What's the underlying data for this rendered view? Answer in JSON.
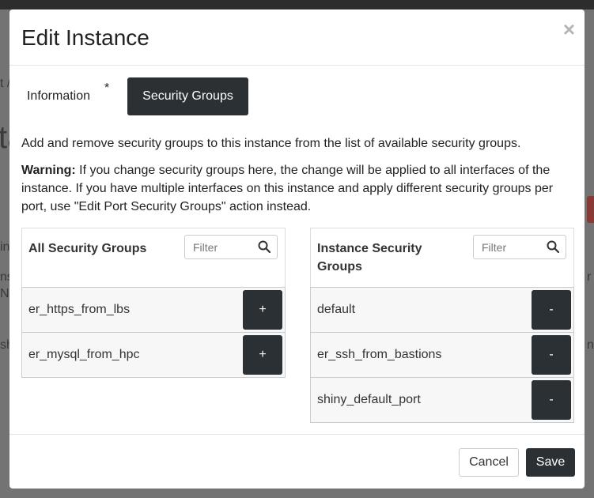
{
  "modal": {
    "title": "Edit Instance",
    "close_glyph": "×"
  },
  "tabs": [
    {
      "label": "Information",
      "required_marker": "*",
      "active": false
    },
    {
      "label": "Security Groups",
      "active": true
    }
  ],
  "description": "Add and remove security groups to this instance from the list of available security groups.",
  "warning": {
    "label": "Warning:",
    "text": " If you change security groups here, the change will be applied to all interfaces of the instance. If you have multiple interfaces on this instance and apply different security groups per port, use \"Edit Port Security Groups\" action instead."
  },
  "all_groups": {
    "title": "All Security Groups",
    "filter_placeholder": "Filter",
    "add_label": "+",
    "items": [
      "er_https_from_lbs",
      "er_mysql_from_hpc"
    ]
  },
  "instance_groups": {
    "title": "Instance Security Groups",
    "filter_placeholder": "Filter",
    "remove_label": "-",
    "items": [
      "default",
      "er_ssh_from_bastions",
      "shiny_default_port"
    ]
  },
  "footer": {
    "cancel_label": "Cancel",
    "save_label": "Save"
  },
  "background": {
    "fragments": [
      "t /",
      "ta",
      "in",
      "ns",
      "Na",
      "sh",
      "r",
      "n"
    ]
  },
  "colors": {
    "primary_button": "#2b3035",
    "modal_bg": "#ffffff",
    "overlay": "#737373"
  },
  "icons": {
    "close": "close-icon",
    "search": "search-icon"
  }
}
